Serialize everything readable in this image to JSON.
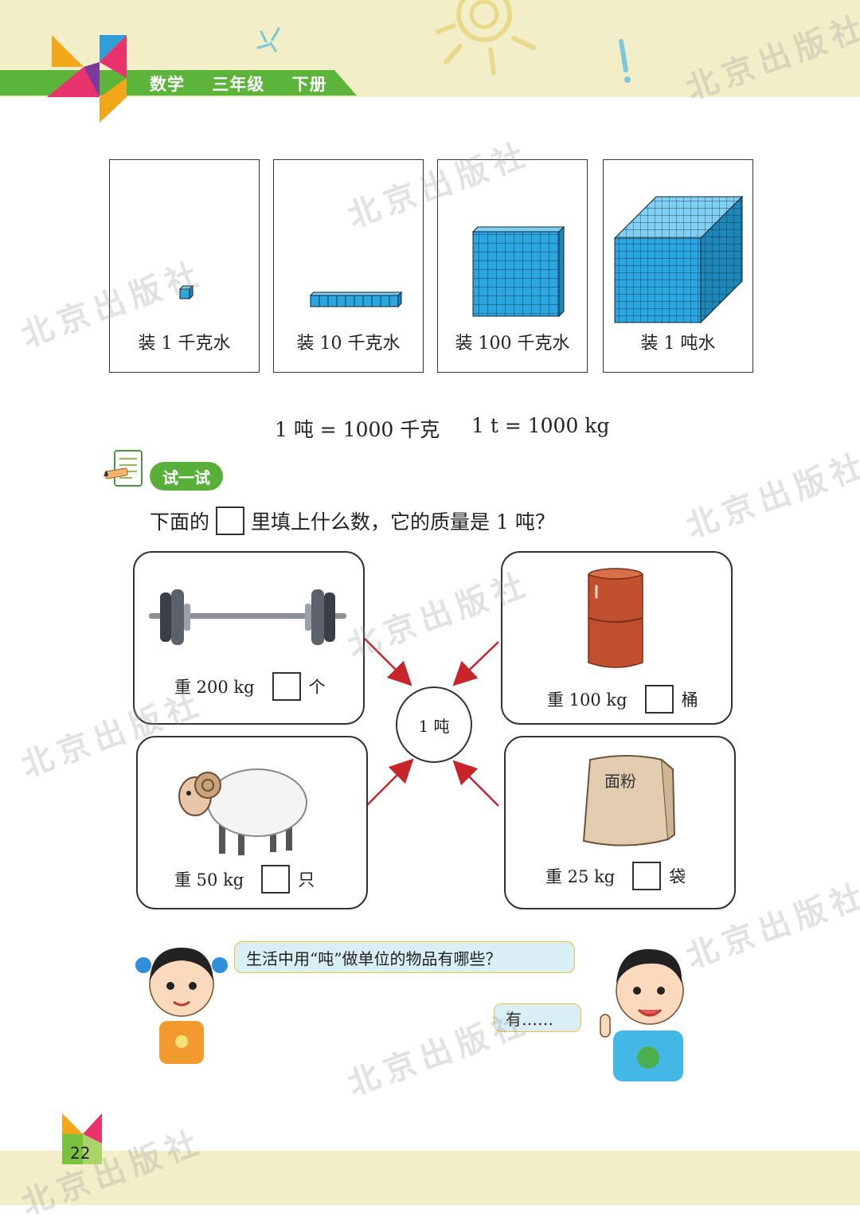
{
  "header": {
    "subject": "数学",
    "grade": "三年级",
    "volume": "下册"
  },
  "watermark": "北京出版社",
  "water_panels": [
    {
      "caption": "装 1 千克水"
    },
    {
      "caption": "装 10 千克水"
    },
    {
      "caption": "装 100 千克水"
    },
    {
      "caption": "装 1 吨水"
    }
  ],
  "equations": {
    "chinese": "1 吨 = 1000 千克",
    "symbol": "1 t = 1000 kg"
  },
  "try_section": {
    "badge": "试一试",
    "question_before": "下面的",
    "question_after": "里填上什么数，它的质量是 1 吨？"
  },
  "center": {
    "label": "1 吨"
  },
  "items": {
    "barbell": {
      "weight": "重 200 kg",
      "unit": "个"
    },
    "barrel": {
      "weight": "重 100 kg",
      "unit": "桶"
    },
    "sheep": {
      "weight": "重 50 kg",
      "unit": "只"
    },
    "flour": {
      "weight": "重 25 kg",
      "unit": "袋",
      "bag_label": "面粉"
    }
  },
  "dialogue": {
    "girl": "生活中用“吨”做单位的物品有哪些？",
    "boy": "有……"
  },
  "page_number": "22",
  "colors": {
    "green": "#5cb53a",
    "band": "#f2efc8",
    "cube": "#2aa6e0",
    "arrow": "#c8242b",
    "barrel": "#c0502e"
  }
}
